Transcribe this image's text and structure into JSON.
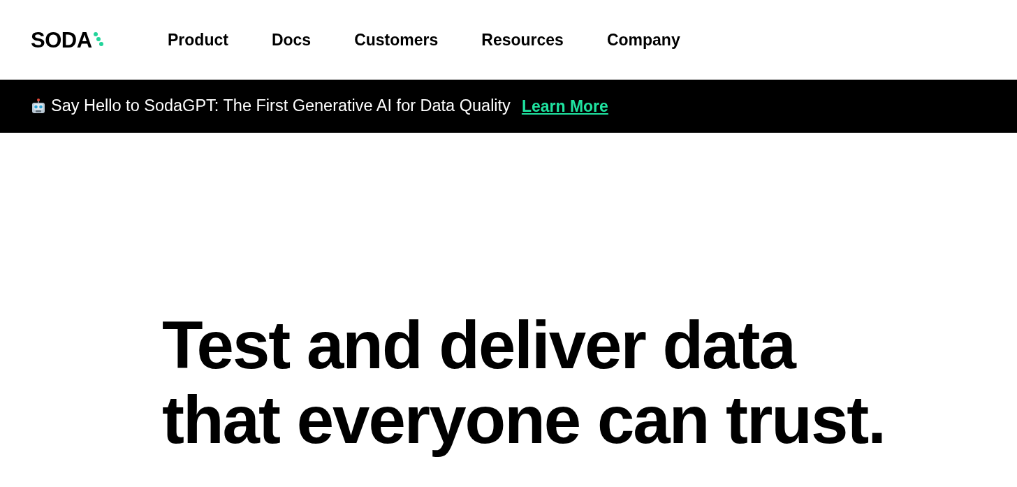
{
  "header": {
    "logo": {
      "text": "SODA"
    },
    "nav": [
      {
        "label": "Product"
      },
      {
        "label": "Docs"
      },
      {
        "label": "Customers"
      },
      {
        "label": "Resources"
      },
      {
        "label": "Company"
      }
    ]
  },
  "announcement": {
    "text": "Say Hello to SodaGPT: The First Generative AI for Data Quality",
    "link": "Learn More"
  },
  "hero": {
    "headline": "Test and deliver data that everyone can trust."
  }
}
